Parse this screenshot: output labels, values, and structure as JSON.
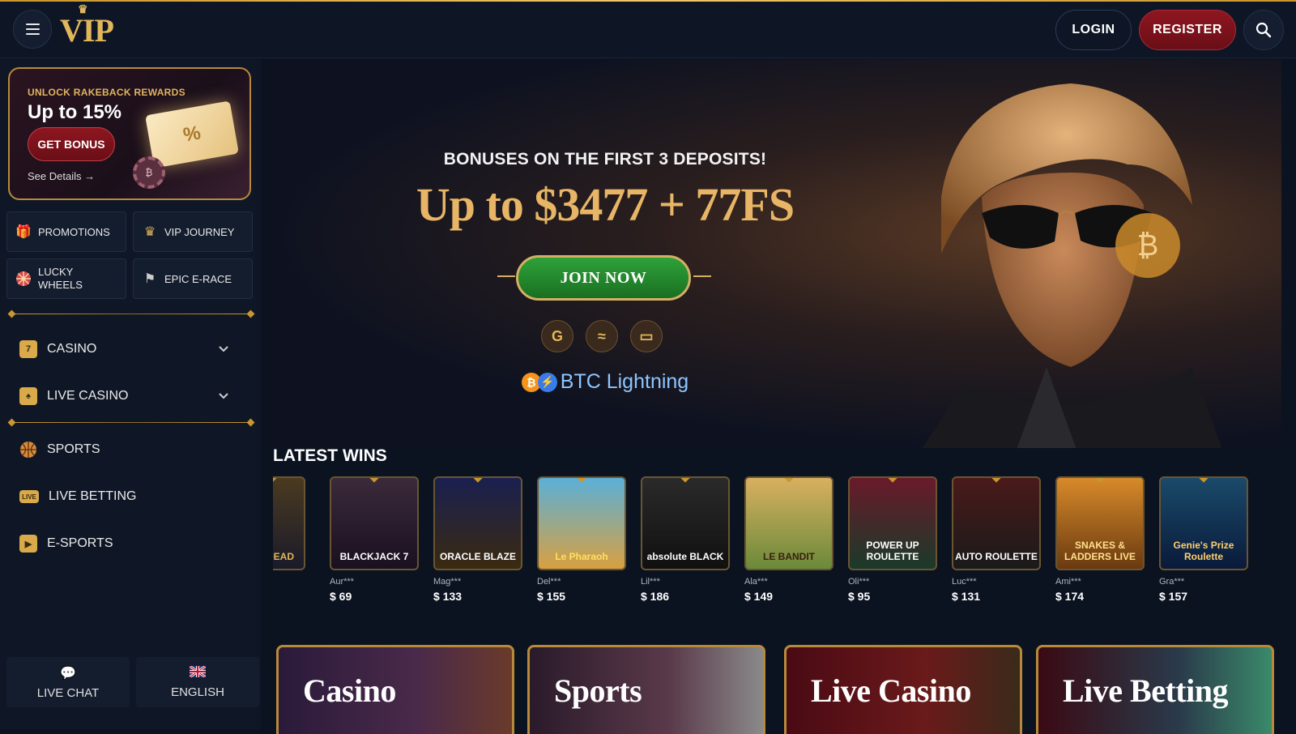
{
  "header": {
    "logo": "VIP",
    "login": "LOGIN",
    "register": "REGISTER"
  },
  "rakeback": {
    "kicker": "UNLOCK RAKEBACK REWARDS",
    "headline": "Up to 15%",
    "button": "GET BONUS",
    "details": "See Details →",
    "ticket_symbol": "%"
  },
  "quick_links": [
    {
      "label": "PROMOTIONS",
      "icon": "gift-icon"
    },
    {
      "label": "VIP JOURNEY",
      "icon": "crown-icon"
    },
    {
      "label": "LUCKY WHEELS",
      "icon": "wheel-icon"
    },
    {
      "label": "EPIC E-RACE",
      "icon": "race-flag-icon"
    }
  ],
  "nav": [
    {
      "label": "CASINO",
      "icon": "slot-machine-icon"
    },
    {
      "label": "LIVE CASINO",
      "icon": "live-dealer-icon"
    },
    {
      "label": "SPORTS",
      "icon": "basketball-icon"
    },
    {
      "label": "LIVE BETTING",
      "icon": "live-badge-icon"
    },
    {
      "label": "E-SPORTS",
      "icon": "play-icon"
    }
  ],
  "footer": {
    "chat": "LIVE CHAT",
    "language": "ENGLISH"
  },
  "hero": {
    "subtitle": "BONUSES ON THE FIRST 3 DEPOSITS!",
    "offer": "Up to $3477 + 77FS",
    "cta": "JOIN NOW",
    "payments": [
      "google-pay-icon",
      "wallet-wave-icon",
      "card-icon"
    ],
    "lightning": "BTC Lightning"
  },
  "latest_wins": {
    "title": "LATEST WINS",
    "items": [
      {
        "game": "OF DEAD",
        "user": "",
        "amount": ""
      },
      {
        "game": "BLACKJACK 7",
        "user": "Aur***",
        "amount": "$ 69"
      },
      {
        "game": "ORACLE BLAZE",
        "user": "Mag***",
        "amount": "$ 133"
      },
      {
        "game": "Le Pharaoh",
        "user": "Del***",
        "amount": "$ 155"
      },
      {
        "game": "absolute BLACK",
        "user": "Lil***",
        "amount": "$ 186"
      },
      {
        "game": "LE BANDIT",
        "user": "Ala***",
        "amount": "$ 149"
      },
      {
        "game": "POWER UP ROULETTE",
        "user": "Oli***",
        "amount": "$ 95"
      },
      {
        "game": "AUTO ROULETTE",
        "user": "Luc***",
        "amount": "$ 131"
      },
      {
        "game": "SNAKES & LADDERS LIVE",
        "user": "Ami***",
        "amount": "$ 174"
      },
      {
        "game": "Genie's Prize Roulette",
        "user": "Gra***",
        "amount": "$ 157"
      }
    ]
  },
  "categories": [
    {
      "label": "Casino"
    },
    {
      "label": "Sports"
    },
    {
      "label": "Live Casino"
    },
    {
      "label": "Live Betting"
    }
  ],
  "colors": {
    "gold": "#c9962f",
    "register_red": "#8e1620",
    "join_green": "#2ea23a",
    "background": "#0b1220"
  }
}
